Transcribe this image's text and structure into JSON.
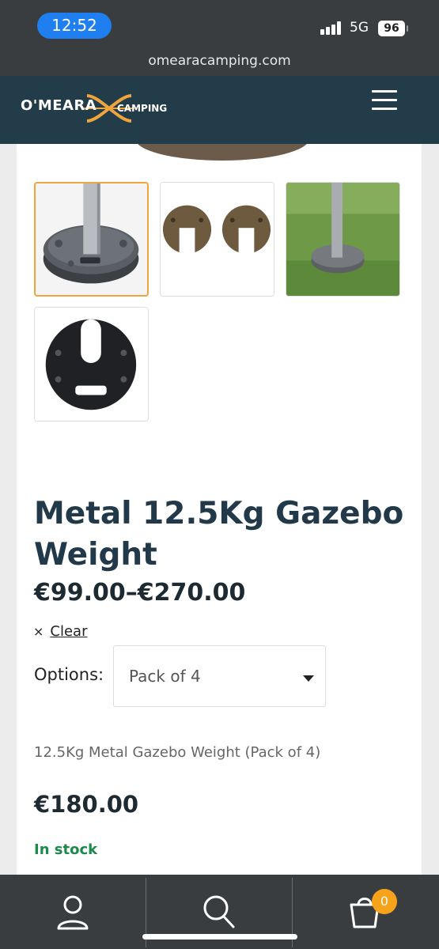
{
  "status_bar": {
    "time": "12:52",
    "network": "5G",
    "battery": "96"
  },
  "browser": {
    "url": "omearacamping.com"
  },
  "header": {
    "logo_main": "O'MEARA",
    "logo_sub": "CAMPING"
  },
  "product": {
    "title": "Metal 12.5Kg Gazebo Weight",
    "price_range": "€99.00–€270.00",
    "clear_label": "Clear",
    "clear_icon": "×",
    "options_label": "Options:",
    "selected_option": "Pack of 4",
    "variant_description": "12.5Kg Metal Gazebo Weight (Pack of 4)",
    "variant_price": "€180.00",
    "stock_status": "In stock"
  },
  "bottom_nav": {
    "cart_count": "0"
  },
  "colors": {
    "header_bg": "#233c49",
    "accent": "#efa43c",
    "badge": "#f6a21a",
    "stock_green": "#1c8a4a",
    "title": "#22394a"
  }
}
